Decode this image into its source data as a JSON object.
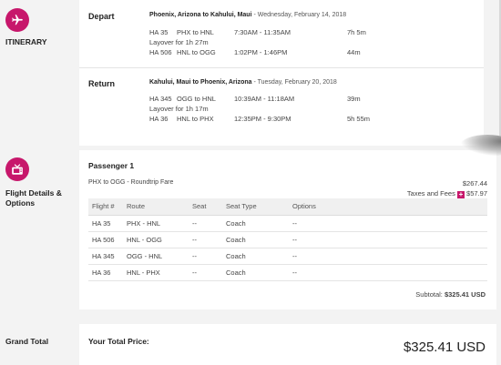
{
  "itinerary": {
    "label": "ITINERARY",
    "depart": {
      "label": "Depart",
      "route": "Phoenix, Arizona to Kahului, Maui",
      "date": " - Wednesday, February 14, 2018",
      "segments": [
        {
          "flight": "HA 35",
          "route": "PHX to HNL",
          "times": "7:30AM - 11:35AM",
          "duration": "7h 5m"
        },
        {
          "flight": "HA 506",
          "route": "HNL to OGG",
          "times": "1:02PM - 1:46PM",
          "duration": "44m"
        }
      ],
      "layover": "Layover for 1h 27m"
    },
    "return": {
      "label": "Return",
      "route": "Kahului, Maui to Phoenix, Arizona",
      "date": " - Tuesday, February 20, 2018",
      "segments": [
        {
          "flight": "HA 345",
          "route": "OGG to HNL",
          "times": "10:39AM - 11:18AM",
          "duration": "39m"
        },
        {
          "flight": "HA 36",
          "route": "HNL to PHX",
          "times": "12:35PM - 9:30PM",
          "duration": "5h 55m"
        }
      ],
      "layover": "Layover for 1h 17m"
    }
  },
  "details": {
    "label_line1": "Flight Details &",
    "label_line2": "Options",
    "passenger": "Passenger 1",
    "fare_label": "PHX to OGG - Roundtrip Fare",
    "fare_amount": "$267.44",
    "taxes_label": "Taxes and Fees",
    "taxes_amount": "$57.97",
    "columns": [
      "Flight #",
      "Route",
      "Seat",
      "Seat Type",
      "Options"
    ],
    "rows": [
      [
        "HA 35",
        "PHX - HNL",
        "--",
        "Coach",
        "--"
      ],
      [
        "HA 506",
        "HNL - OGG",
        "--",
        "Coach",
        "--"
      ],
      [
        "HA 345",
        "OGG - HNL",
        "--",
        "Coach",
        "--"
      ],
      [
        "HA 36",
        "HNL - PHX",
        "--",
        "Coach",
        "--"
      ]
    ],
    "subtotal_label": "Subtotal:",
    "subtotal_amount": "$325.41 USD"
  },
  "total": {
    "label": "Grand Total",
    "price_label": "Your Total Price:",
    "price": "$325.41 USD"
  },
  "colors": {
    "accent": "#c7176b"
  }
}
